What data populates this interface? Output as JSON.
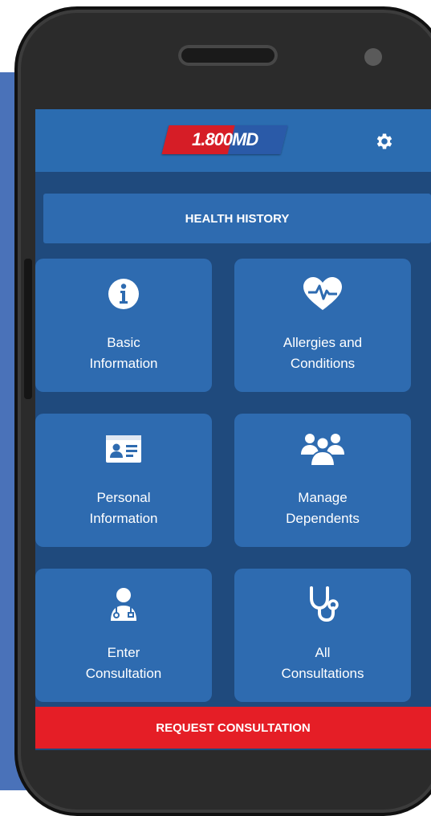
{
  "app": {
    "logo_text": "1.800MD",
    "settings_icon": "gear-icon"
  },
  "section": {
    "title": "HEALTH HISTORY"
  },
  "tiles": [
    {
      "label": "Basic\nInformation",
      "icon": "info-icon"
    },
    {
      "label": "Allergies and\nConditions",
      "icon": "heart-pulse-icon"
    },
    {
      "label": "Personal\nInformation",
      "icon": "id-card-icon"
    },
    {
      "label": "Manage\nDependents",
      "icon": "users-group-icon"
    },
    {
      "label": "Enter\nConsultation",
      "icon": "doctor-icon"
    },
    {
      "label": "All\nConsultations",
      "icon": "stethoscope-icon"
    }
  ],
  "footer": {
    "request_label": "REQUEST CONSULTATION"
  },
  "colors": {
    "primary_blue": "#2e6bb0",
    "dark_blue": "#1f4a7d",
    "accent_red": "#e51e26",
    "background_blue": "#4a72b9"
  }
}
